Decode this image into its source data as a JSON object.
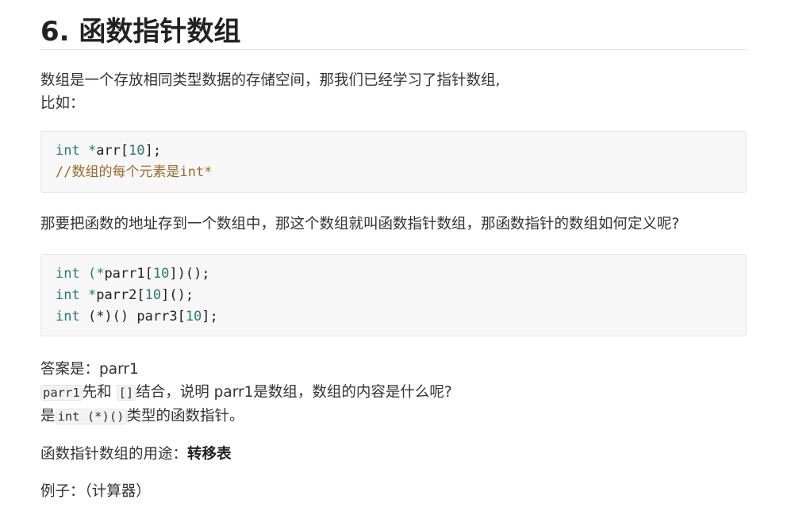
{
  "heading": "6. 函数指针数组",
  "para1_line1": "数组是一个存放相同类型数据的存储空间，那我们已经学习了指针数组,",
  "para1_line2": "比如：",
  "code1": {
    "l1_kw": "int",
    "l1_star": " *",
    "l1_id": "arr",
    "l1_b1": "[",
    "l1_num": "10",
    "l1_b2": "];",
    "l2_comment": "//数组的每个元素是int*"
  },
  "para2": "那要把函数的地址存到一个数组中，那这个数组就叫函数指针数组，那函数指针的数组如何定义呢?",
  "code2": {
    "l1_kw": "int",
    "l1_a": " (*",
    "l1_id": "parr1",
    "l1_b": "[",
    "l1_num": "10",
    "l1_c": "])();",
    "l2_kw": "int",
    "l2_a": " *",
    "l2_id": "parr2",
    "l2_b": "[",
    "l2_num": "10",
    "l2_c": "]();",
    "l3_kw": "int",
    "l3_a": " (*)() ",
    "l3_id": "parr3",
    "l3_b": "[",
    "l3_num": "10",
    "l3_c": "];"
  },
  "answer": {
    "line1": "答案是：parr1",
    "line2_code1": "parr1",
    "line2_t1": "先和",
    "line2_code2": "[]",
    "line2_t2": "结合，说明 parr1是数组，数组的内容是什么呢?",
    "line3_t1": "是",
    "line3_code": "int (*)()",
    "line3_t2": "类型的函数指针。"
  },
  "usage": {
    "label": "函数指针数组的用途：",
    "bold": "转移表"
  },
  "example": "例子：（计算器）"
}
